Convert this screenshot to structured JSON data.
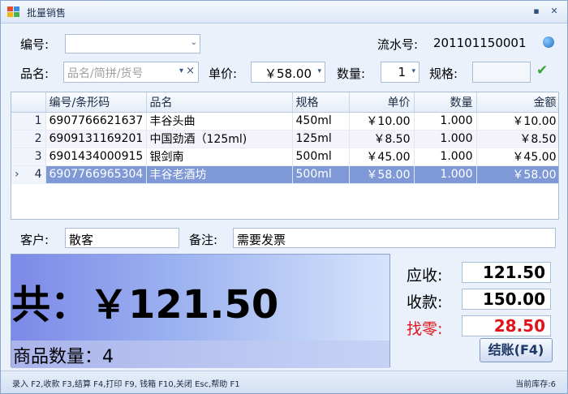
{
  "window": {
    "title": "批量销售",
    "minimize_glyph": "▪",
    "close_glyph": "✕"
  },
  "row1": {
    "code_label": "编号:",
    "code_value": "",
    "serial_label": "流水号:",
    "serial_value": "201101150001",
    "info_icon": "info-icon"
  },
  "row2": {
    "name_label": "品名:",
    "name_placeholder": "品名/简拼/货号",
    "price_label": "单价:",
    "price_value": "￥58.00",
    "qty_label": "数量:",
    "qty_value": "1",
    "spec_label": "规格:",
    "spec_value": ""
  },
  "grid": {
    "columns": [
      "",
      "编号/条形码",
      "品名",
      "规格",
      "单价",
      "数量",
      "金额"
    ],
    "rows": [
      {
        "n": "1",
        "code": "6907766621637",
        "name": "丰谷头曲",
        "spec": "450ml",
        "price": "￥10.00",
        "qty": "1.000",
        "amount": "￥10.00"
      },
      {
        "n": "2",
        "code": "6909131169201",
        "name": "中国劲酒（125ml)",
        "spec": "125ml",
        "price": "￥8.50",
        "qty": "1.000",
        "amount": "￥8.50"
      },
      {
        "n": "3",
        "code": "6901434000915",
        "name": "银剑南",
        "spec": "500ml",
        "price": "￥45.00",
        "qty": "1.000",
        "amount": "￥45.00"
      },
      {
        "n": "4",
        "code": "6907766965304",
        "name": "丰谷老酒坊",
        "spec": "500ml",
        "price": "￥58.00",
        "qty": "1.000",
        "amount": "￥58.00"
      }
    ],
    "current_row_marker": "›"
  },
  "customer": {
    "label": "客户:",
    "value": "散客",
    "note_label": "备注:",
    "note_value": "需要发票"
  },
  "summary": {
    "total_text": "共：￥121.50",
    "count_text": "商品数量：4"
  },
  "payment": {
    "receivable_label": "应收:",
    "receivable_value": "121.50",
    "received_label": "收款:",
    "received_value": "150.00",
    "change_label": "找零:",
    "change_value": "28.50",
    "checkout_label": "结账(F4)"
  },
  "status": {
    "shortcuts": "录入 F2,收款 F3,结算 F4,打印 F9, 钱箱 F10,关闭 Esc,帮助 F1",
    "stock": "当前库存:6"
  },
  "colors": {
    "change_red": "#e0141a",
    "selected_row": "#7f99d6",
    "accent_green": "#3aa63a"
  }
}
